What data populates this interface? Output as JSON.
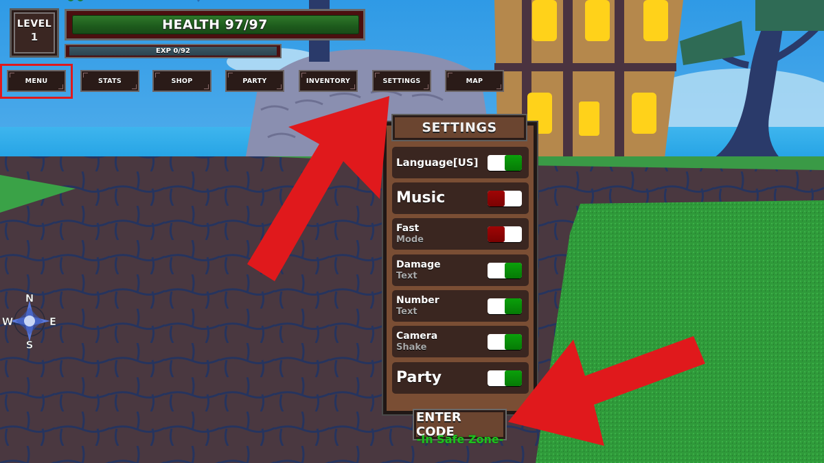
{
  "hud": {
    "level_label": "LEVEL",
    "level_value": "1",
    "health_text": "HEALTH 97/97",
    "health_current": 97,
    "health_max": 97,
    "exp_text": "EXP 0/92",
    "exp_current": 0,
    "exp_max": 92
  },
  "nav": {
    "buttons": [
      {
        "label": "MENU"
      },
      {
        "label": "STATS"
      },
      {
        "label": "SHOP"
      },
      {
        "label": "PARTY"
      },
      {
        "label": "INVENTORY"
      },
      {
        "label": "SETTINGS"
      },
      {
        "label": "MAP"
      }
    ],
    "highlighted": "MENU"
  },
  "compass": {
    "n": "N",
    "e": "E",
    "s": "S",
    "w": "W"
  },
  "settings": {
    "title": "SETTINGS",
    "items": [
      {
        "line1": "Language[US]",
        "line2": "",
        "state": "on"
      },
      {
        "line1": "Music",
        "line2": "",
        "state": "off"
      },
      {
        "line1": "Fast",
        "line2": "Mode",
        "state": "off"
      },
      {
        "line1": "Damage",
        "line2": "Text",
        "state": "on"
      },
      {
        "line1": "Number",
        "line2": "Text",
        "state": "on"
      },
      {
        "line1": "Camera",
        "line2": "Shake",
        "state": "on"
      },
      {
        "line1": "Party",
        "line2": "",
        "state": "on"
      }
    ],
    "enter_code_label": "ENTER CODE",
    "zone_status": "-In Safe Zone-"
  },
  "colors": {
    "toggle_on": "#079007",
    "toggle_off": "#8f0303",
    "annotation_red": "#e0191c",
    "safe_zone_green": "#1ec21e"
  }
}
